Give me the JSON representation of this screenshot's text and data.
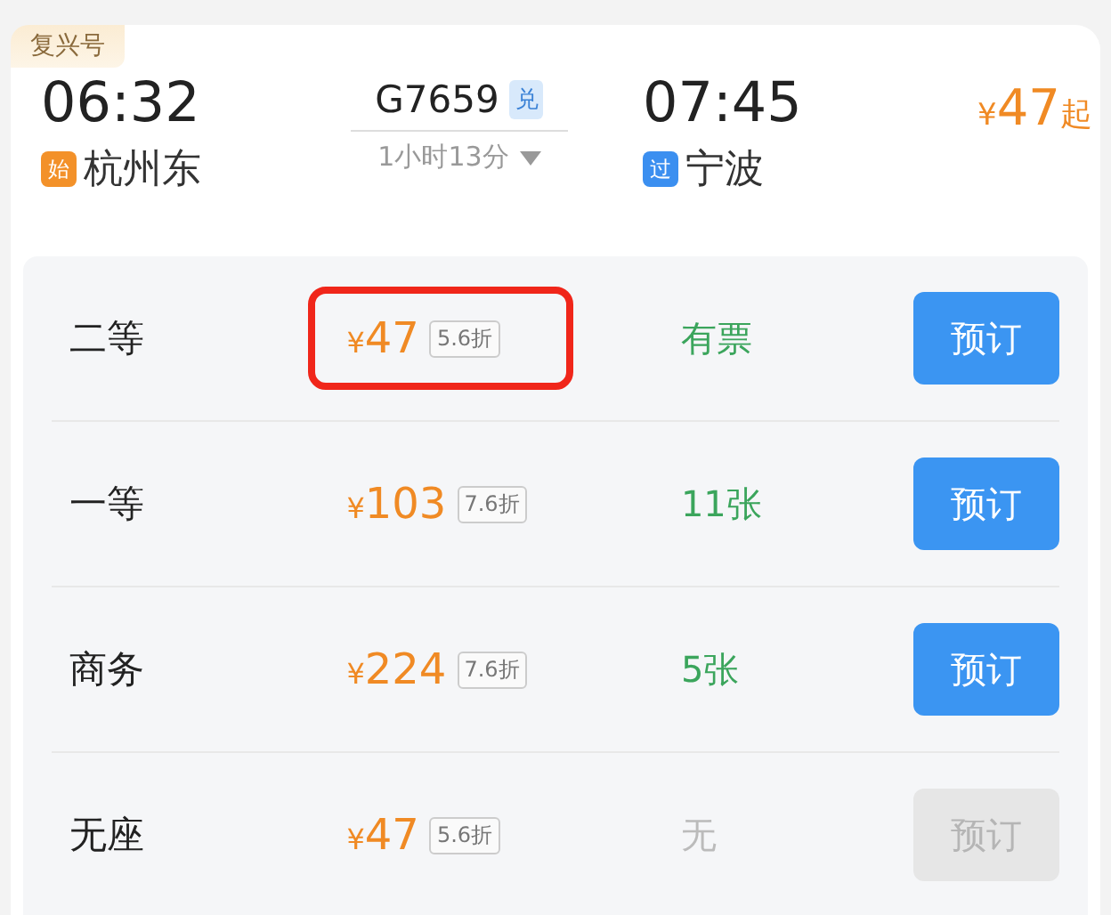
{
  "train": {
    "type_badge": "复兴号",
    "depart_time": "06:32",
    "number": "G7659",
    "number_tag": "兑",
    "arrive_time": "07:45",
    "from_price": {
      "currency": "¥",
      "amount": "47",
      "suffix": "起"
    },
    "duration": "1小时13分",
    "depart_station": {
      "tag": "始",
      "kind": "start",
      "name": "杭州东"
    },
    "arrive_station": {
      "tag": "过",
      "kind": "pass",
      "name": "宁波"
    }
  },
  "seats": [
    {
      "class": "二等",
      "currency": "¥",
      "amount": "47",
      "discount": "5.6折",
      "availability": "有票",
      "available": true,
      "button": "预订",
      "highlighted": true
    },
    {
      "class": "一等",
      "currency": "¥",
      "amount": "103",
      "discount": "7.6折",
      "availability": "11张",
      "available": true,
      "button": "预订",
      "highlighted": false
    },
    {
      "class": "商务",
      "currency": "¥",
      "amount": "224",
      "discount": "7.6折",
      "availability": "5张",
      "available": true,
      "button": "预订",
      "highlighted": false
    },
    {
      "class": "无座",
      "currency": "¥",
      "amount": "47",
      "discount": "5.6折",
      "availability": "无",
      "available": false,
      "button": "预订",
      "highlighted": false
    }
  ]
}
